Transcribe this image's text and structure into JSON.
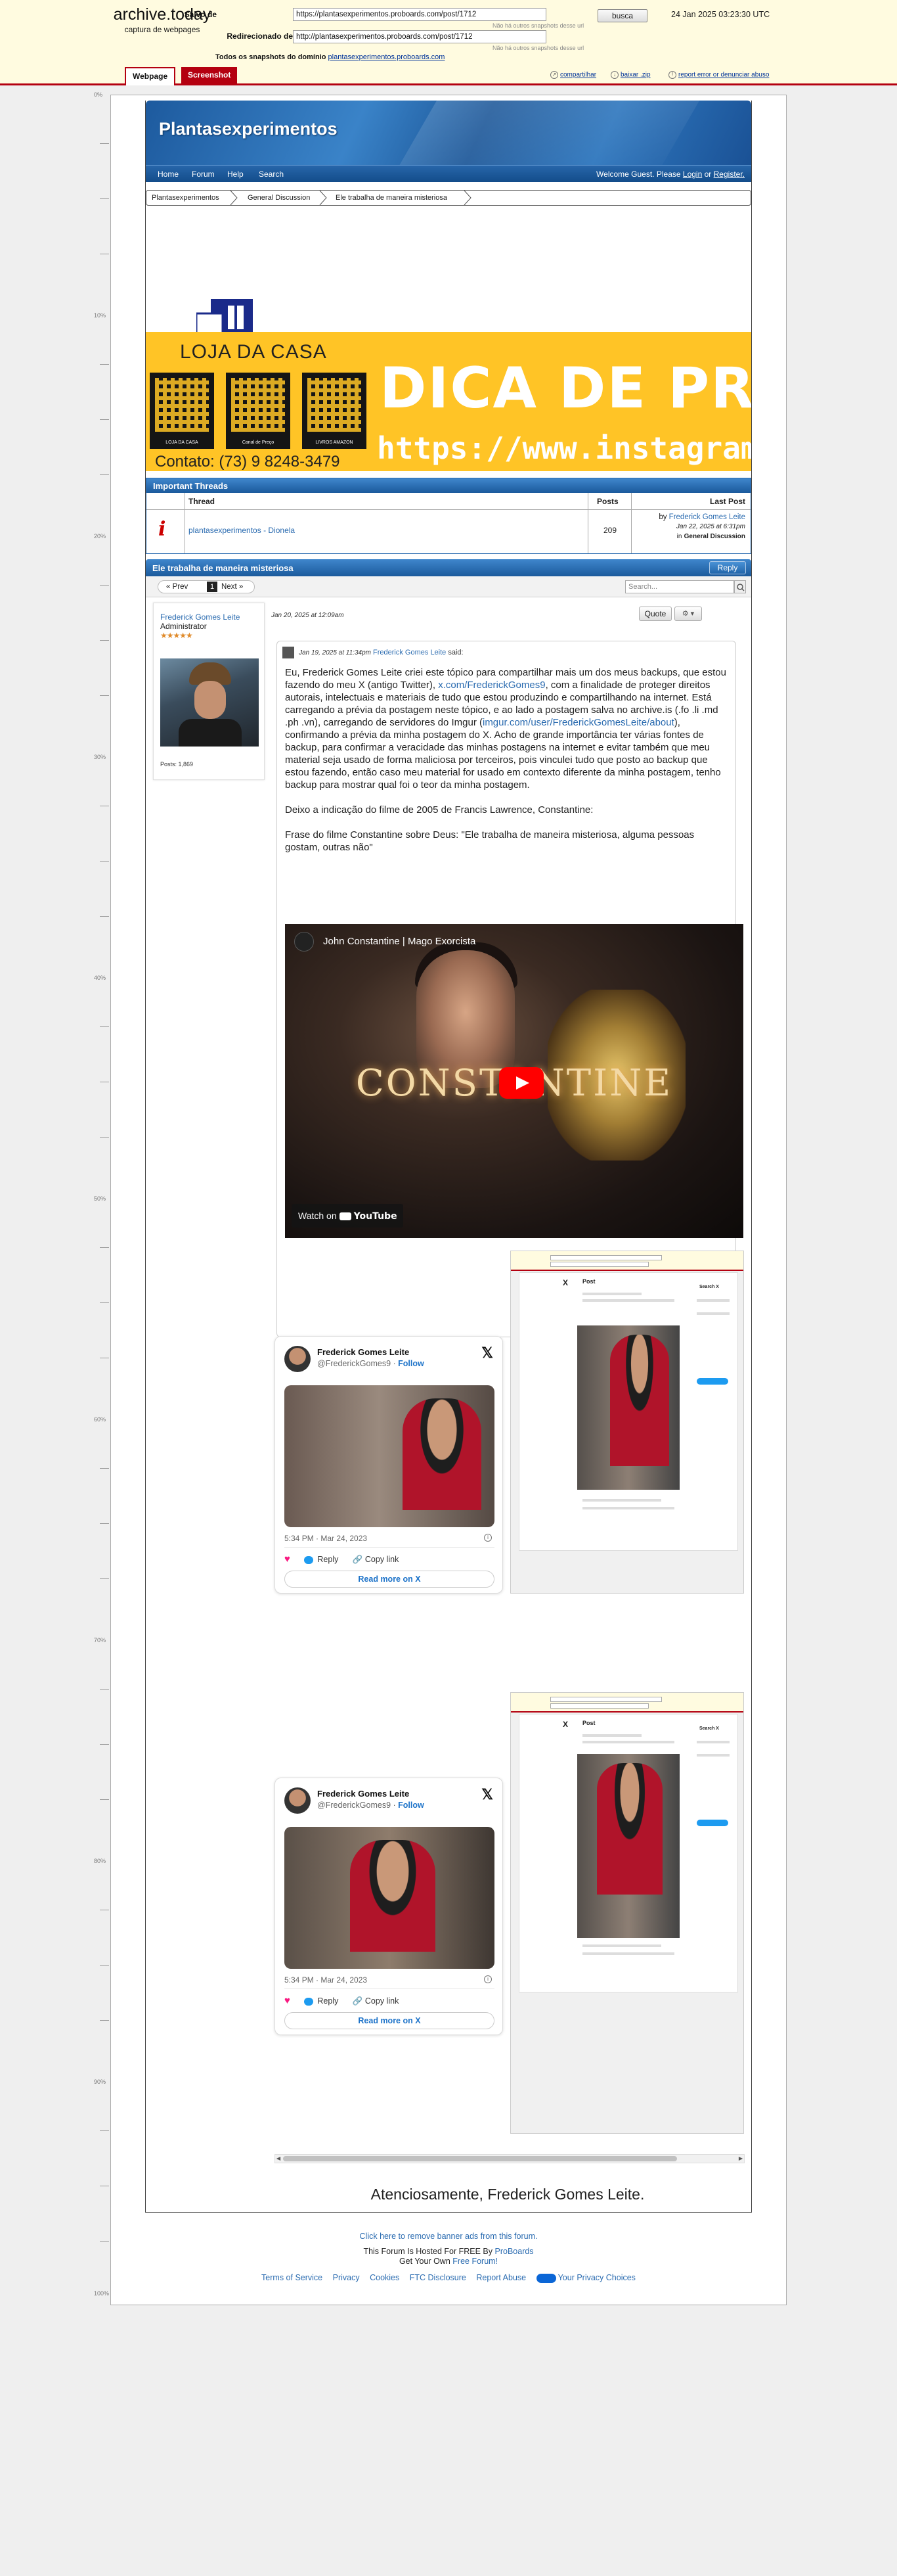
{
  "archive": {
    "logo_title": "archive.today",
    "logo_sub": "captura de webpages",
    "saved_label": "Salvo de",
    "saved_url": "https://plantasexperimentos.proboards.com/post/1712",
    "saved_hint": "Não há outros snapshots desse url",
    "search_button": "busca",
    "date": "24 Jan 2025 03:23:30 UTC",
    "redirect_label": "Redirecionado de",
    "redirect_url": "http://plantasexperimentos.proboards.com/post/1712",
    "redirect_hint": "Não há outros snapshots desse url",
    "todos_text": "Todos os snapshots  do domínio",
    "todos_link": "plantasexperimentos.proboards.com",
    "tab_webpage": "Webpage",
    "tab_screenshot": "Screenshot",
    "action_share": "compartilhar",
    "action_download": "baixar .zip",
    "action_report": "report error or denunciar abuso"
  },
  "ruler": [
    "0%",
    "10%",
    "20%",
    "30%",
    "40%",
    "50%",
    "60%",
    "70%",
    "80%",
    "90%",
    "100%"
  ],
  "forum": {
    "title": "Plantasexperimentos",
    "nav": [
      "Home",
      "Forum",
      "Help",
      "Search"
    ],
    "welcome_prefix": "Welcome Guest. Please",
    "login": "Login",
    "or": "or",
    "register": "Register."
  },
  "breadcrumbs": [
    "Plantasexperimentos",
    "General Discussion",
    "Ele trabalha de maneira misteriosa"
  ],
  "ad": {
    "store_name": "LOJA DA CASA",
    "qr_captions": [
      "LOJA DA CASA",
      "Canal de Preço",
      "LIVROS AMAZON"
    ],
    "headline": "DICA DE PRESENTE",
    "instagram": "https://www.instagram.com/lo",
    "contact": "Contato: (73) 9 8248-3479"
  },
  "important": {
    "header": "Important Threads",
    "col_thread": "Thread",
    "col_posts": "Posts",
    "col_last": "Last Post",
    "thread_title": "plantasexperimentos - Dionela",
    "posts": "209",
    "last_by": "by",
    "last_author": "Frederick Gomes Leite",
    "last_date": "Jan 22, 2025 at 6:31pm",
    "last_in": "in",
    "last_board": "General Discussion"
  },
  "thread": {
    "title": "Ele trabalha de maneira misteriosa",
    "reply": "Reply",
    "prev": "« Prev",
    "page": "1",
    "next": "Next »",
    "search_placeholder": "Search..."
  },
  "post": {
    "author": "Frederick Gomes Leite",
    "role": "Administrator",
    "stars": "★★★★★",
    "posts": "Posts: 1,869",
    "date": "Jan 20, 2025 at 12:09am",
    "quote_btn": "Quote",
    "gear_btn": "⚙ ▾",
    "quote_date": "Jan 19, 2025 at 11:34pm",
    "quote_author": "Frederick Gomes Leite",
    "said": "said:",
    "p1_a": "Eu, Frederick Gomes Leite criei este tópico para compartilhar mais um dos meus backups, que estou fazendo do meu X (antigo Twitter), ",
    "p1_link": "x.com/FrederickGomes9",
    "p1_b": ", com a finalidade de proteger direitos autorais, intelectuais e materiais de tudo que estou produzindo e compartilhando na internet. Está carregando a prévia da postagem neste tópico, e ao lado a postagem salva no archive.is (.fo .li .md .ph .vn), carregando de servidores do Imgur (",
    "p1_link2": "imgur.com/user/FrederickGomesLeite/about",
    "p1_c": "), confirmando a prévia da minha postagem do X. Acho de grande importância ter várias fontes de backup, para confirmar a veracidade das minhas postagens na internet e evitar também que meu material seja usado de forma maliciosa por terceiros, pois vinculei tudo que posto ao backup que estou fazendo, então caso meu material for usado em contexto diferente da minha postagem, tenho backup para mostrar qual foi o teor da minha postagem.",
    "p2": "Deixo a indicação do filme de 2005 de Francis Lawrence, Constantine:",
    "p3": "Frase do filme Constantine sobre Deus: \"Ele trabalha de maneira misteriosa, alguma pessoas gostam, outras não\"",
    "video_title": "John Constantine | Mago Exorcista",
    "video_overlay": "CONSTANTINE",
    "watch_on": "Watch on",
    "youtube": "YouTube",
    "signature": "Atenciosamente, Frederick Gomes Leite."
  },
  "tweets": [
    {
      "name": "Frederick Gomes Leite",
      "handle": "@FrederickGomes9 · ",
      "follow": "Follow",
      "date": "5:34 PM · Mar 24, 2023",
      "reply": "Reply",
      "copy": "Copy link",
      "more": "Read more on X"
    },
    {
      "name": "Frederick Gomes Leite",
      "handle": "@FrederickGomes9 · ",
      "follow": "Follow",
      "date": "5:34 PM · Mar 24, 2023",
      "reply": "Reply",
      "copy": "Copy link",
      "more": "Read more on X"
    }
  ],
  "archived_shot": {
    "x": "X",
    "post": "Post",
    "side": "Search X"
  },
  "footer": {
    "remove_ads": "Click here to remove banner ads from this forum.",
    "hosted_prefix": "This Forum Is Hosted For FREE By",
    "hosted_link": "ProBoards",
    "get_own": "Get Your Own",
    "free_forum": "Free Forum!",
    "links": [
      "Terms of Service",
      "Privacy",
      "Cookies",
      "FTC Disclosure",
      "Report Abuse",
      "Your Privacy Choices"
    ]
  }
}
